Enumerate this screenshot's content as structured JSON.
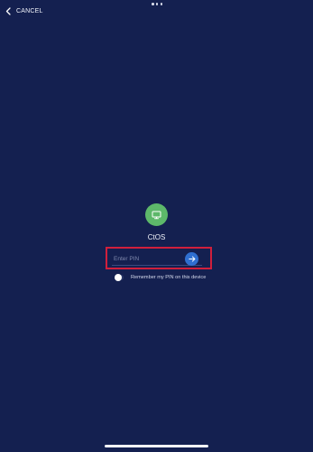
{
  "header": {
    "cancel_label": "CANCEL",
    "back_icon": "chevron-left-icon",
    "more_icon": "ellipsis-icon"
  },
  "app": {
    "icon": "monitor-icon",
    "icon_color": "#5db86a",
    "name": "CtOS"
  },
  "pin": {
    "placeholder": "Enter PIN",
    "value": "",
    "submit_icon": "arrow-right-icon",
    "submit_color": "#2f6fd0",
    "highlight_color": "#d01f3c"
  },
  "remember": {
    "label": "Remember my PIN on this device",
    "enabled": false
  },
  "colors": {
    "background": "#142050",
    "text": "#ffffff"
  }
}
